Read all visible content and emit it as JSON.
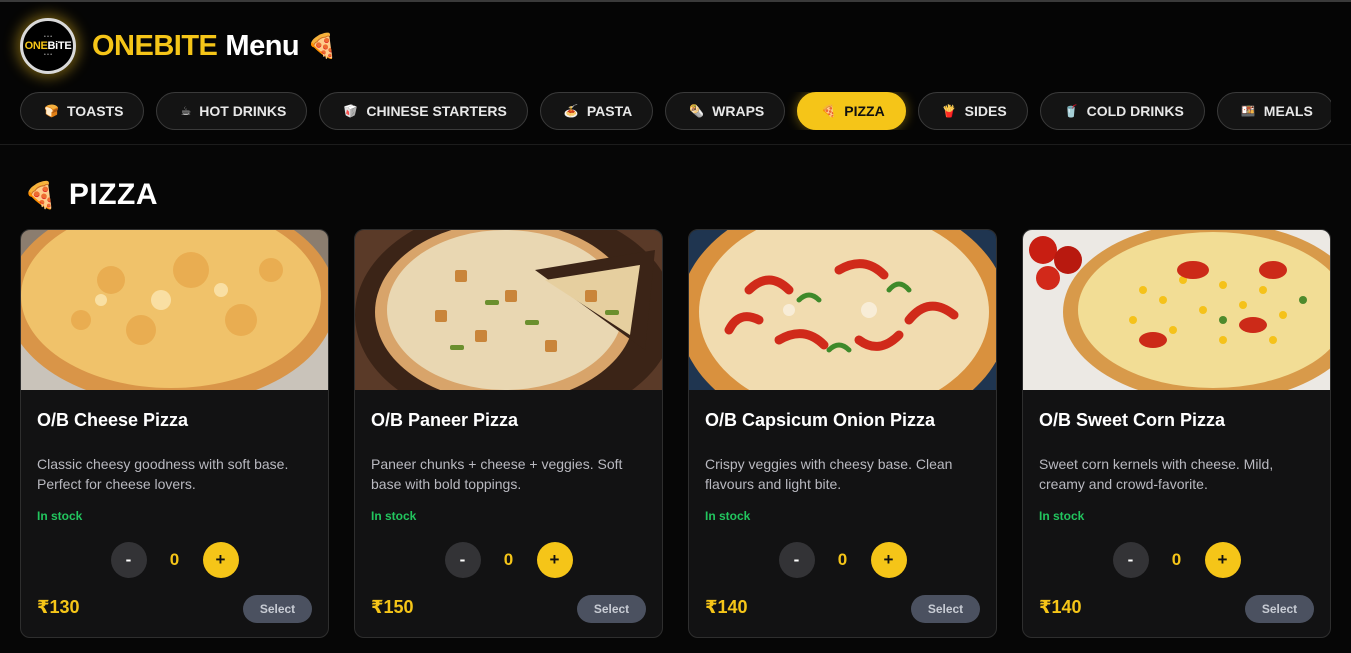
{
  "brand": {
    "logo_text_a": "ONE",
    "logo_text_b": "BiTE",
    "title_accent": "ONEBITE",
    "title_rest": "Menu",
    "title_icon": "🍕"
  },
  "tabs": [
    {
      "icon": "🍞",
      "label": "TOASTS",
      "active": false
    },
    {
      "icon": "☕",
      "label": "HOT DRINKS",
      "active": false
    },
    {
      "icon": "🥡",
      "label": "CHINESE STARTERS",
      "active": false
    },
    {
      "icon": "🍝",
      "label": "PASTA",
      "active": false
    },
    {
      "icon": "🌯",
      "label": "WRAPS",
      "active": false
    },
    {
      "icon": "🍕",
      "label": "PIZZA",
      "active": true
    },
    {
      "icon": "🍟",
      "label": "SIDES",
      "active": false
    },
    {
      "icon": "🥤",
      "label": "COLD DRINKS",
      "active": false
    },
    {
      "icon": "🍱",
      "label": "MEALS",
      "active": false
    },
    {
      "icon": "🍔",
      "label": "",
      "active": false
    }
  ],
  "section": {
    "icon": "🍕",
    "title": "PIZZA"
  },
  "products": [
    {
      "name": "O/B Cheese Pizza",
      "description": "Classic cheesy goodness with soft base. Perfect for cheese lovers.",
      "stock": "In stock",
      "quantity": "0",
      "price": "₹130",
      "select_label": "Select"
    },
    {
      "name": "O/B Paneer Pizza",
      "description": "Paneer chunks + cheese + veggies. Soft base with bold toppings.",
      "stock": "In stock",
      "quantity": "0",
      "price": "₹150",
      "select_label": "Select"
    },
    {
      "name": "O/B Capsicum Onion Pizza",
      "description": "Crispy veggies with cheesy base. Clean flavours and light bite.",
      "stock": "In stock",
      "quantity": "0",
      "price": "₹140",
      "select_label": "Select"
    },
    {
      "name": "O/B Sweet Corn Pizza",
      "description": "Sweet corn kernels with cheese. Mild, creamy and crowd-favorite.",
      "stock": "In stock",
      "quantity": "0",
      "price": "₹140",
      "select_label": "Select"
    }
  ],
  "controls": {
    "minus": "-",
    "plus": "+"
  },
  "colors": {
    "accent": "#f5c518",
    "background": "#060606",
    "card": "#121213",
    "in_stock": "#22c55e"
  }
}
